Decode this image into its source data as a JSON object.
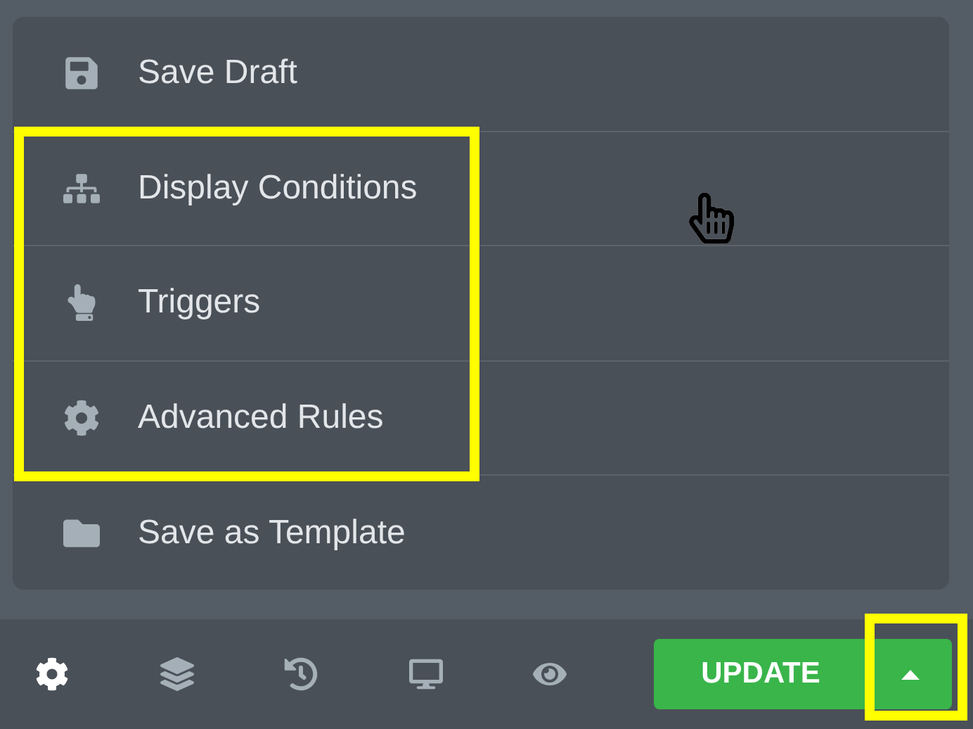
{
  "menu": {
    "items": [
      {
        "label": "Save Draft",
        "highlighted": false
      },
      {
        "label": "Display Conditions",
        "highlighted": true
      },
      {
        "label": "Triggers",
        "highlighted": true
      },
      {
        "label": "Advanced Rules",
        "highlighted": true
      },
      {
        "label": "Save as Template",
        "highlighted": false
      }
    ]
  },
  "toolbar": {
    "tools": [
      {
        "selected": true
      },
      {
        "selected": false
      },
      {
        "selected": false
      },
      {
        "selected": false
      },
      {
        "selected": false
      }
    ],
    "update_button": {
      "label": "UPDATE"
    },
    "options_button": {
      "highlighted": true
    }
  }
}
